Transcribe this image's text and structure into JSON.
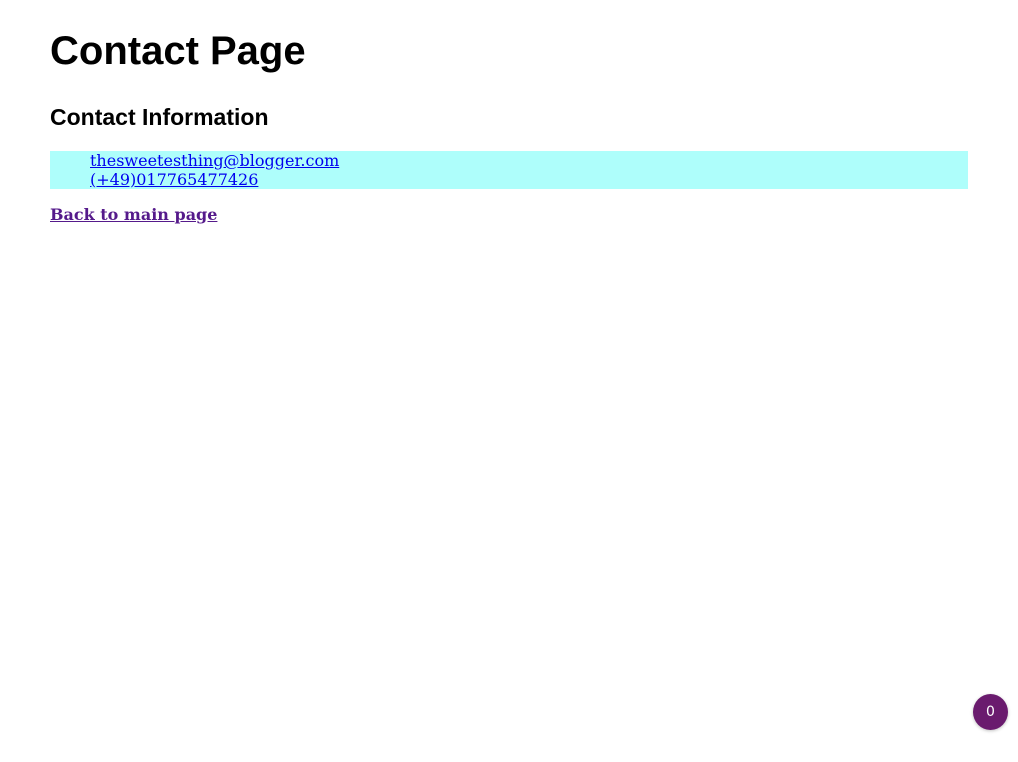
{
  "page": {
    "title": "Contact Page"
  },
  "contact": {
    "heading": "Contact Information",
    "email": "thesweetesthing@blogger.com",
    "phone": "(+49)017765477426",
    "box_color": "#aefefb"
  },
  "navigation": {
    "back_label": "Back to main page"
  },
  "badge": {
    "count": "0",
    "color": "#6a1b6e"
  }
}
